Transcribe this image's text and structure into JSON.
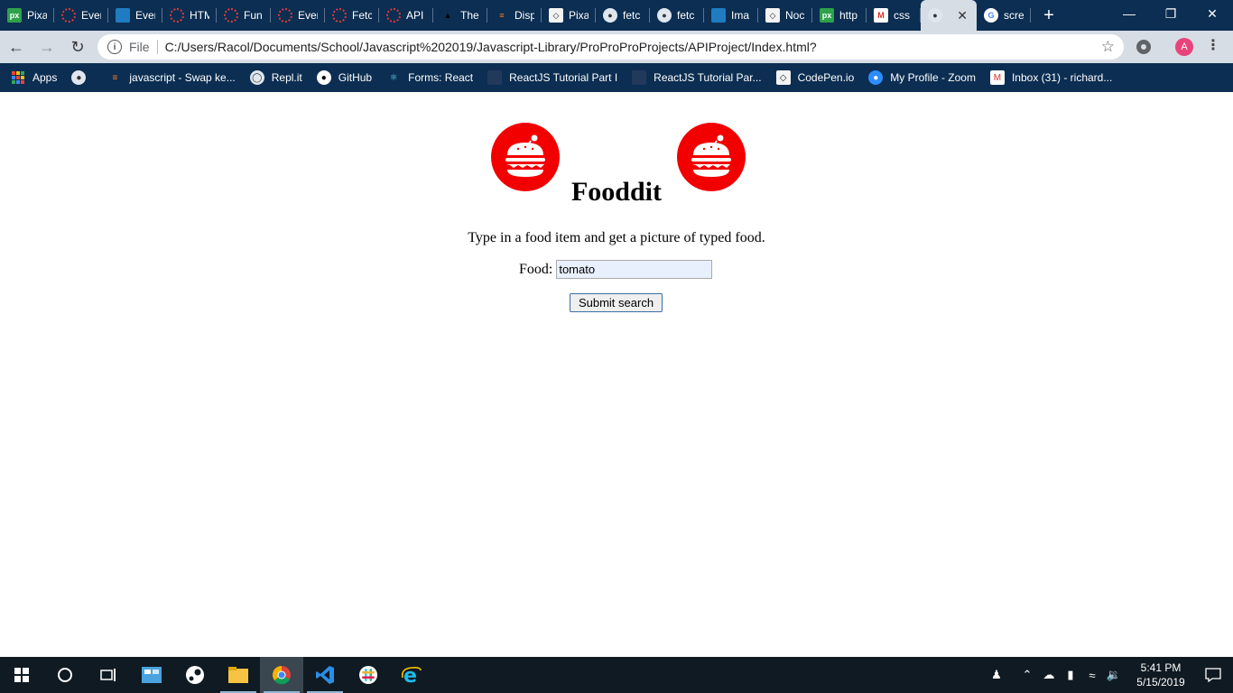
{
  "browser": {
    "tabs": [
      {
        "title": "Pixa",
        "icon": "pixabay-icon"
      },
      {
        "title": "Ever",
        "icon": "loading-ring-icon"
      },
      {
        "title": "Ever",
        "icon": "bookmark-app-icon"
      },
      {
        "title": "HTM",
        "icon": "loading-ring-icon"
      },
      {
        "title": "Fun",
        "icon": "loading-ring-icon"
      },
      {
        "title": "Ever",
        "icon": "loading-ring-icon"
      },
      {
        "title": "Fetc",
        "icon": "loading-ring-icon"
      },
      {
        "title": "API",
        "icon": "loading-ring-icon"
      },
      {
        "title": "The",
        "icon": "dog-icon"
      },
      {
        "title": "Disp",
        "icon": "stackoverflow-icon"
      },
      {
        "title": "Pixa",
        "icon": "codepen-icon"
      },
      {
        "title": "fetc",
        "icon": "globe-icon"
      },
      {
        "title": "fetc",
        "icon": "globe-icon"
      },
      {
        "title": "Ima",
        "icon": "bookmark-app-icon"
      },
      {
        "title": "Noc",
        "icon": "codepen-icon"
      },
      {
        "title": "http",
        "icon": "pixabay-icon"
      },
      {
        "title": "css",
        "icon": "gmail-icon"
      }
    ],
    "active_tab": {
      "icon": "globe-icon"
    },
    "last_tab": {
      "title": "scre",
      "icon": "google-icon"
    },
    "address": {
      "scheme_label": "File",
      "url": "C:/Users/Racol/Documents/School/Javascript%202019/Javascript-Library/ProProProProjects/APIProject/Index.html?"
    },
    "profile_initial": "A",
    "bookmarks": [
      {
        "label": "Apps",
        "icon": "apps-grid-icon"
      },
      {
        "label": "",
        "icon": "globe-icon"
      },
      {
        "label": "javascript - Swap ke...",
        "icon": "stackoverflow-icon"
      },
      {
        "label": "Repl.it",
        "icon": "replit-icon"
      },
      {
        "label": "GitHub",
        "icon": "github-icon"
      },
      {
        "label": "Forms: React",
        "icon": "react-icon"
      },
      {
        "label": "ReactJS Tutorial Part I",
        "icon": "page-icon"
      },
      {
        "label": "ReactJS Tutorial Par...",
        "icon": "page-icon"
      },
      {
        "label": "CodePen.io",
        "icon": "codepen-icon"
      },
      {
        "label": "My Profile - Zoom",
        "icon": "zoom-icon"
      },
      {
        "label": "Inbox (31) - richard...",
        "icon": "gmail-icon"
      }
    ]
  },
  "page": {
    "title": "Fooddit",
    "description": "Type in a food item and get a picture of typed food.",
    "food_label": "Food:",
    "food_value": "tomato",
    "submit_label": "Submit search"
  },
  "taskbar": {
    "time": "5:41 PM",
    "date": "5/15/2019"
  },
  "colors": {
    "logo_red": "#f20000",
    "browser_frame": "#0b2e52",
    "toolbar": "#d7dde4"
  }
}
